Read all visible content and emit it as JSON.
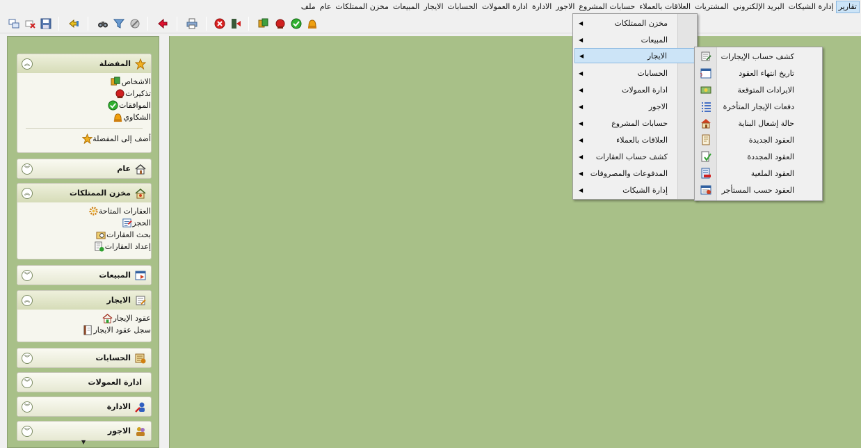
{
  "menubar": {
    "items": [
      "تقارير",
      "إدارة الشيكات",
      "البريد الإلكتروني",
      "المشتريات",
      "العلاقات بالعملاء",
      "حسابات المشروع",
      "الاجور",
      "الادارة",
      "ادارة العمولات",
      "الحسابات",
      "الايجار",
      "المبيعات",
      "مخزن الممتلكات",
      "عام",
      "ملف"
    ]
  },
  "sidebar": {
    "favorites": {
      "title": "المفضلة",
      "items": [
        "الاشخاص",
        "تذكيرات",
        "الموافقات",
        "الشكاوي"
      ],
      "add_label": "أضف إلى المفضلة"
    },
    "general": {
      "title": "عام"
    },
    "property_store": {
      "title": "مخزن الممتلكات",
      "items": [
        "العقارات المتاحة",
        "الحجز",
        "بحث العقارات",
        "إعداد العقارات"
      ]
    },
    "sales": {
      "title": "المبيعات"
    },
    "rent": {
      "title": "الايجار",
      "items": [
        "عقود الإيجار",
        "سجل عقود الايجار"
      ]
    },
    "accounts": {
      "title": "الحسابات"
    },
    "commissions": {
      "title": "ادارة العمولات"
    },
    "admin": {
      "title": "الادارة"
    },
    "wages": {
      "title": "الاجور"
    }
  },
  "reports_menu": {
    "items": [
      "مخزن الممتلكات",
      "المبيعات",
      "الايجار",
      "الحسابات",
      "ادارة العمولات",
      "الاجور",
      "حسابات المشروع",
      "العلاقات بالعملاء",
      "كشف حساب العقارات",
      "المدفوعات والمصروفات",
      "إدارة الشيكات"
    ]
  },
  "rent_submenu": {
    "items": [
      "كشف حساب الإيجارات",
      "تاريخ انتهاء العقود",
      "الايرادات المتوقعة",
      "دفعات الإيجار المتأخرة",
      "حالة إشغال البناية",
      "العقود الجديدة",
      "العقود المجددة",
      "العقود الملغية",
      "العقود حسب المستأجر"
    ]
  }
}
